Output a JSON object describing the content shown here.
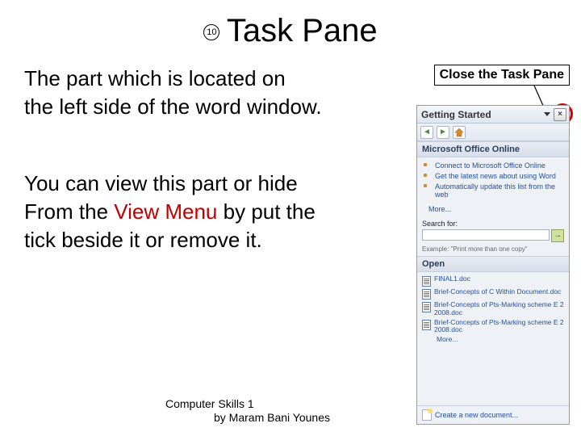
{
  "slide": {
    "number": "10",
    "title": "Task Pane",
    "para1_line1": "The part which is located on",
    "para1_line2": "the left side of the word window.",
    "para2_line1": "You can view this part or hide",
    "para2_line2a": "From the ",
    "para2_line2b": "View Menu",
    "para2_line2c": " by put the",
    "para2_line3": "tick beside it or remove it.",
    "footer_line1": "Computer Skills 1",
    "footer_line2": "by Maram Bani Younes"
  },
  "callout": {
    "label": "Close the Task Pane"
  },
  "pane": {
    "titlebar": "Getting Started",
    "close_glyph": "×",
    "nav_back": "◄",
    "nav_fwd": "►",
    "section_office": "Microsoft Office Online",
    "office_links": [
      "Connect to Microsoft Office Online",
      "Get the latest news about using Word",
      "Automatically update this list from the web"
    ],
    "more_link": "More...",
    "search_label": "Search for:",
    "example_text": "Example: \"Print more than one copy\"",
    "section_open": "Open",
    "recent_files": [
      "FINAL1.doc",
      "Brief-Concepts of C Within Document.doc",
      "Brief-Concepts of Pts-Marking scheme E 2 2008.doc",
      "Brief-Concepts of Pts-Marking scheme E 2 2008.doc"
    ],
    "more_docs": "More...",
    "create_new": "Create a new document..."
  }
}
